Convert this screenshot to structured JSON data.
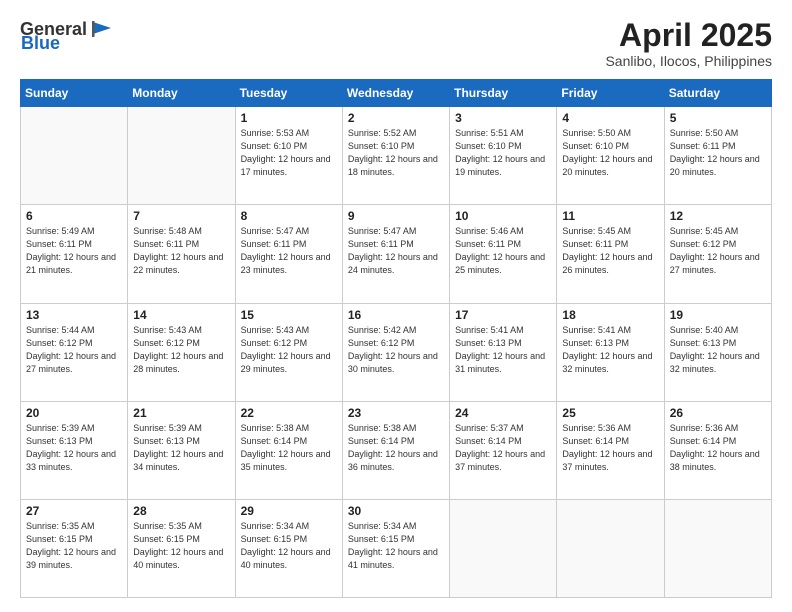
{
  "header": {
    "logo_general": "General",
    "logo_blue": "Blue",
    "title": "April 2025",
    "subtitle": "Sanlibo, Ilocos, Philippines"
  },
  "days_of_week": [
    "Sunday",
    "Monday",
    "Tuesday",
    "Wednesday",
    "Thursday",
    "Friday",
    "Saturday"
  ],
  "weeks": [
    [
      {
        "day": "",
        "info": ""
      },
      {
        "day": "",
        "info": ""
      },
      {
        "day": "1",
        "info": "Sunrise: 5:53 AM\nSunset: 6:10 PM\nDaylight: 12 hours and 17 minutes."
      },
      {
        "day": "2",
        "info": "Sunrise: 5:52 AM\nSunset: 6:10 PM\nDaylight: 12 hours and 18 minutes."
      },
      {
        "day": "3",
        "info": "Sunrise: 5:51 AM\nSunset: 6:10 PM\nDaylight: 12 hours and 19 minutes."
      },
      {
        "day": "4",
        "info": "Sunrise: 5:50 AM\nSunset: 6:10 PM\nDaylight: 12 hours and 20 minutes."
      },
      {
        "day": "5",
        "info": "Sunrise: 5:50 AM\nSunset: 6:11 PM\nDaylight: 12 hours and 20 minutes."
      }
    ],
    [
      {
        "day": "6",
        "info": "Sunrise: 5:49 AM\nSunset: 6:11 PM\nDaylight: 12 hours and 21 minutes."
      },
      {
        "day": "7",
        "info": "Sunrise: 5:48 AM\nSunset: 6:11 PM\nDaylight: 12 hours and 22 minutes."
      },
      {
        "day": "8",
        "info": "Sunrise: 5:47 AM\nSunset: 6:11 PM\nDaylight: 12 hours and 23 minutes."
      },
      {
        "day": "9",
        "info": "Sunrise: 5:47 AM\nSunset: 6:11 PM\nDaylight: 12 hours and 24 minutes."
      },
      {
        "day": "10",
        "info": "Sunrise: 5:46 AM\nSunset: 6:11 PM\nDaylight: 12 hours and 25 minutes."
      },
      {
        "day": "11",
        "info": "Sunrise: 5:45 AM\nSunset: 6:11 PM\nDaylight: 12 hours and 26 minutes."
      },
      {
        "day": "12",
        "info": "Sunrise: 5:45 AM\nSunset: 6:12 PM\nDaylight: 12 hours and 27 minutes."
      }
    ],
    [
      {
        "day": "13",
        "info": "Sunrise: 5:44 AM\nSunset: 6:12 PM\nDaylight: 12 hours and 27 minutes."
      },
      {
        "day": "14",
        "info": "Sunrise: 5:43 AM\nSunset: 6:12 PM\nDaylight: 12 hours and 28 minutes."
      },
      {
        "day": "15",
        "info": "Sunrise: 5:43 AM\nSunset: 6:12 PM\nDaylight: 12 hours and 29 minutes."
      },
      {
        "day": "16",
        "info": "Sunrise: 5:42 AM\nSunset: 6:12 PM\nDaylight: 12 hours and 30 minutes."
      },
      {
        "day": "17",
        "info": "Sunrise: 5:41 AM\nSunset: 6:13 PM\nDaylight: 12 hours and 31 minutes."
      },
      {
        "day": "18",
        "info": "Sunrise: 5:41 AM\nSunset: 6:13 PM\nDaylight: 12 hours and 32 minutes."
      },
      {
        "day": "19",
        "info": "Sunrise: 5:40 AM\nSunset: 6:13 PM\nDaylight: 12 hours and 32 minutes."
      }
    ],
    [
      {
        "day": "20",
        "info": "Sunrise: 5:39 AM\nSunset: 6:13 PM\nDaylight: 12 hours and 33 minutes."
      },
      {
        "day": "21",
        "info": "Sunrise: 5:39 AM\nSunset: 6:13 PM\nDaylight: 12 hours and 34 minutes."
      },
      {
        "day": "22",
        "info": "Sunrise: 5:38 AM\nSunset: 6:14 PM\nDaylight: 12 hours and 35 minutes."
      },
      {
        "day": "23",
        "info": "Sunrise: 5:38 AM\nSunset: 6:14 PM\nDaylight: 12 hours and 36 minutes."
      },
      {
        "day": "24",
        "info": "Sunrise: 5:37 AM\nSunset: 6:14 PM\nDaylight: 12 hours and 37 minutes."
      },
      {
        "day": "25",
        "info": "Sunrise: 5:36 AM\nSunset: 6:14 PM\nDaylight: 12 hours and 37 minutes."
      },
      {
        "day": "26",
        "info": "Sunrise: 5:36 AM\nSunset: 6:14 PM\nDaylight: 12 hours and 38 minutes."
      }
    ],
    [
      {
        "day": "27",
        "info": "Sunrise: 5:35 AM\nSunset: 6:15 PM\nDaylight: 12 hours and 39 minutes."
      },
      {
        "day": "28",
        "info": "Sunrise: 5:35 AM\nSunset: 6:15 PM\nDaylight: 12 hours and 40 minutes."
      },
      {
        "day": "29",
        "info": "Sunrise: 5:34 AM\nSunset: 6:15 PM\nDaylight: 12 hours and 40 minutes."
      },
      {
        "day": "30",
        "info": "Sunrise: 5:34 AM\nSunset: 6:15 PM\nDaylight: 12 hours and 41 minutes."
      },
      {
        "day": "",
        "info": ""
      },
      {
        "day": "",
        "info": ""
      },
      {
        "day": "",
        "info": ""
      }
    ]
  ]
}
